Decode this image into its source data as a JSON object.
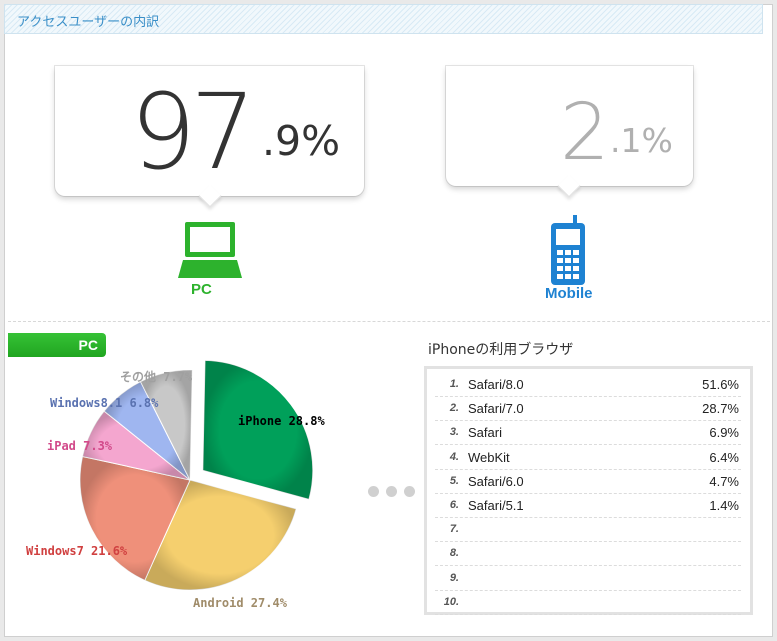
{
  "header": {
    "title": "アクセスユーザーの内訳"
  },
  "summary": {
    "pc": {
      "int": "97",
      "dec": ".9%",
      "label": "PC"
    },
    "mobile": {
      "int": "2",
      "dec": ".1%",
      "label": "Mobile"
    }
  },
  "colors": {
    "pc_green": "#2db22d",
    "mobile_blue": "#1e82d2",
    "header_text": "#3a8fc8"
  },
  "pie_section": {
    "tab_label": "PC"
  },
  "chart_data": {
    "type": "pie",
    "title": "",
    "slices": [
      {
        "label": "iPhone 28.8%",
        "value": 28.8,
        "color": "#00a05a",
        "label_color": "#000000",
        "exploded": true
      },
      {
        "label": "Android 27.4%",
        "value": 27.4,
        "color": "#f5cf6e",
        "label_color": "#a08c6a",
        "exploded": false
      },
      {
        "label": "Windows7 21.6%",
        "value": 21.6,
        "color": "#ef907a",
        "label_color": "#d04040",
        "exploded": false
      },
      {
        "label": "iPad 7.3%",
        "value": 7.3,
        "color": "#f4a6cf",
        "label_color": "#d24a8a",
        "exploded": false
      },
      {
        "label": "Windows8.1 6.8%",
        "value": 6.8,
        "color": "#9fb6f0",
        "label_color": "#5a72b0",
        "exploded": false
      },
      {
        "label": "その他 7.7%",
        "value": 7.7,
        "color": "#c8c8c8",
        "label_color": "#a0a0a0",
        "exploded": false
      }
    ]
  },
  "browsers": {
    "title": "iPhoneの利用ブラウザ",
    "rows": [
      {
        "rank": "1.",
        "name": "Safari/8.0",
        "pct": "51.6%"
      },
      {
        "rank": "2.",
        "name": "Safari/7.0",
        "pct": "28.7%"
      },
      {
        "rank": "3.",
        "name": "Safari",
        "pct": "6.9%"
      },
      {
        "rank": "4.",
        "name": "WebKit",
        "pct": "6.4%"
      },
      {
        "rank": "5.",
        "name": "Safari/6.0",
        "pct": "4.7%"
      },
      {
        "rank": "6.",
        "name": "Safari/5.1",
        "pct": "1.4%"
      },
      {
        "rank": "7.",
        "name": "",
        "pct": ""
      },
      {
        "rank": "8.",
        "name": "",
        "pct": ""
      },
      {
        "rank": "9.",
        "name": "",
        "pct": ""
      },
      {
        "rank": "10.",
        "name": "",
        "pct": ""
      }
    ]
  }
}
